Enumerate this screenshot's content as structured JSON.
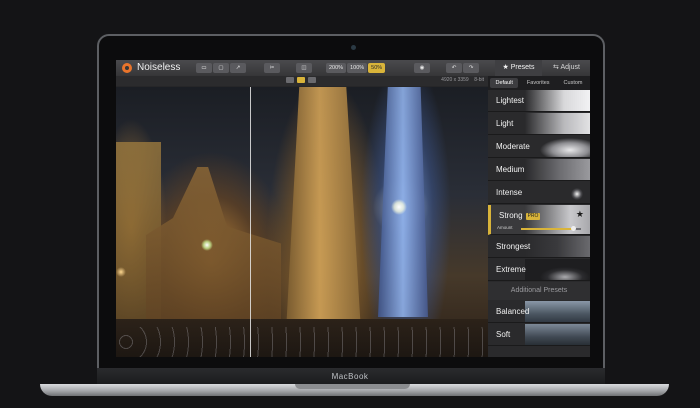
{
  "device": {
    "brand_label": "MacBook"
  },
  "app": {
    "title": "Noiseless"
  },
  "toolbar": {
    "zoom_options": [
      {
        "label": "200%",
        "active": false
      },
      {
        "label": "100%",
        "active": false
      },
      {
        "label": "50%",
        "active": true
      }
    ],
    "presets_label": "★ Presets",
    "adjust_label": "⇆ Adjust"
  },
  "image_info": {
    "dimensions": "4920 x 3359",
    "bit_depth": "8-bit"
  },
  "panel": {
    "tabs": [
      {
        "label": "Default",
        "active": true
      },
      {
        "label": "Favorites",
        "active": false
      },
      {
        "label": "Custom",
        "active": false
      }
    ],
    "presets": [
      {
        "label": "Lightest",
        "thumb_color": "#d8d8da"
      },
      {
        "label": "Light",
        "thumb_color": "#b9b9bc"
      },
      {
        "label": "Moderate",
        "thumb_color": "#8e8e92"
      },
      {
        "label": "Medium",
        "thumb_color": "#6e6e72"
      },
      {
        "label": "Intense",
        "thumb_color": "#4c4c50"
      }
    ],
    "selected_preset": {
      "label": "Strong",
      "badge": "PRO",
      "amount_label": "Amount",
      "amount_fraction": 0.88
    },
    "presets_after": [
      {
        "label": "Strongest",
        "thumb_color": "#3a3a3d"
      },
      {
        "label": "Extreme",
        "thumb_color": "#2c2c2f"
      }
    ],
    "additional_header": "Additional Presets",
    "additional_presets": [
      {
        "label": "Balanced",
        "thumb_color": "#5d6a76"
      },
      {
        "label": "Soft",
        "thumb_color": "#4c5660"
      }
    ]
  },
  "colors": {
    "accent": "#d9b43a",
    "logo": "#e9742b"
  }
}
